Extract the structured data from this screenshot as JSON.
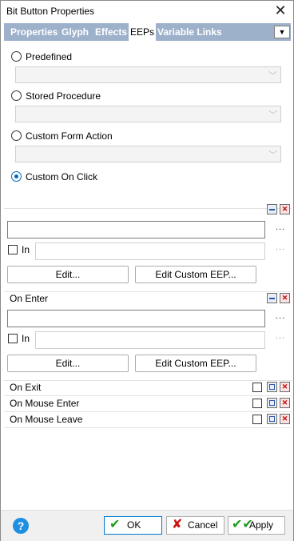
{
  "window": {
    "title": "Bit Button Properties"
  },
  "tabs": [
    {
      "label": "Properties"
    },
    {
      "label": "Glyph"
    },
    {
      "label": "Effects"
    },
    {
      "label": "EEPs"
    },
    {
      "label": "Variable Links"
    }
  ],
  "options": {
    "predefined": "Predefined",
    "stored_procedure": "Stored Procedure",
    "custom_form_action": "Custom Form Action",
    "custom_on_click": "Custom On Click",
    "selected": "Custom On Click"
  },
  "eep_sections": [
    {
      "title": "",
      "in_label": "In",
      "edit_label": "Edit...",
      "edit_custom_label": "Edit Custom EEP...",
      "ellipsis": "..."
    },
    {
      "title": "On Enter",
      "in_label": "In",
      "edit_label": "Edit...",
      "edit_custom_label": "Edit Custom EEP...",
      "ellipsis": "..."
    }
  ],
  "collapsed_sections": [
    {
      "title": "On Exit"
    },
    {
      "title": "On Mouse Enter"
    },
    {
      "title": "On Mouse Leave"
    }
  ],
  "footer": {
    "ok": "OK",
    "cancel": "Cancel",
    "apply": "Apply"
  },
  "colors": {
    "tab_bar": "#9db1ca",
    "accent": "#0067c0",
    "help": "#1e8fe1",
    "ok_check": "#1a9c1a",
    "cancel_x": "#d01010"
  }
}
